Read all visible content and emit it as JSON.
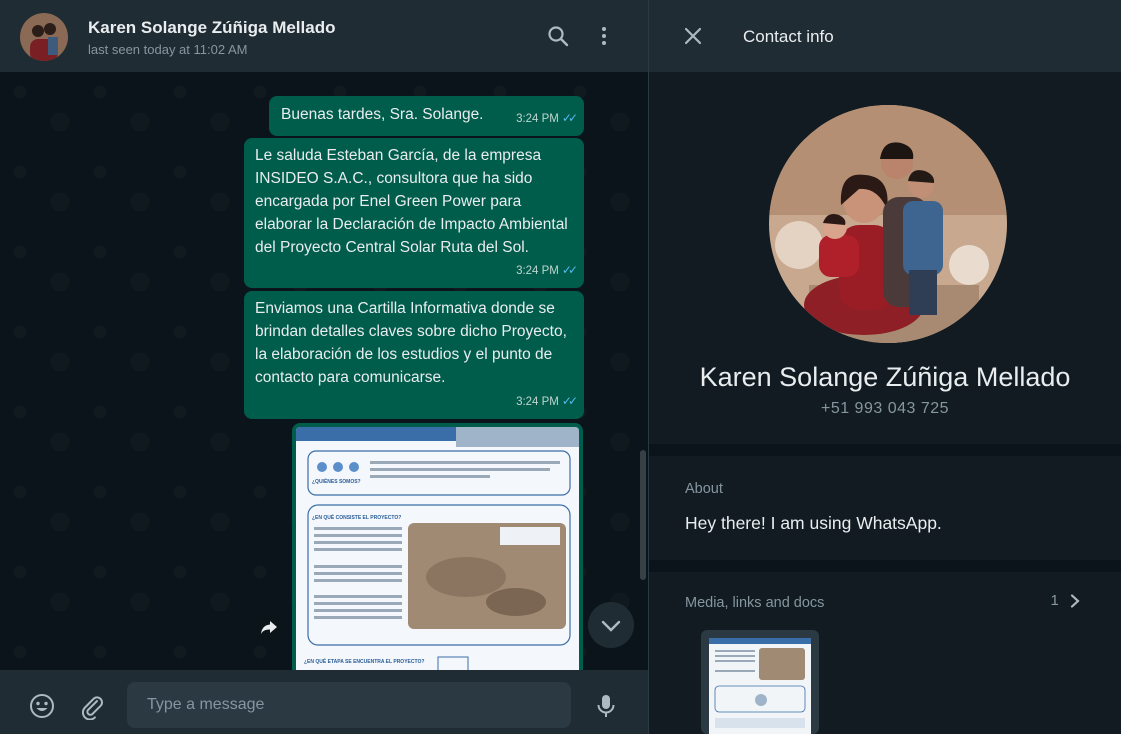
{
  "chat": {
    "contact_name": "Karen Solange Zúñiga Mellado",
    "status": "last seen today at 11:02 AM",
    "messages": [
      {
        "text": "Buenas tardes, Sra. Solange.",
        "time": "3:24 PM"
      },
      {
        "text": "Le saluda Esteban García, de la empresa INSIDEO S.A.C., consultora que ha sido encargada por Enel Green Power para elaborar la Declaración de Impacto Ambiental del Proyecto Central Solar Ruta del Sol.",
        "time": "3:24 PM"
      },
      {
        "text": "Enviamos una Cartilla Informativa donde se brindan detalles claves sobre dicho Proyecto, la elaboración de los estudios y el punto de contacto para comunicarse.",
        "time": "3:24 PM"
      }
    ],
    "document": {
      "section1": "¿QUIÉNES SOMOS?",
      "section2": "¿EN QUÉ CONSISTE EL PROYECTO?",
      "section3": "¿EN QUÉ ETAPA SE ENCUENTRA EL PROYECTO?"
    },
    "input_placeholder": "Type a message"
  },
  "contact_info": {
    "title": "Contact info",
    "name": "Karen Solange Zúñiga Mellado",
    "phone": "+51 993 043 725",
    "about_label": "About",
    "about_text": "Hey there! I am using WhatsApp.",
    "media_label": "Media, links and docs",
    "media_count": "1"
  },
  "colors": {
    "outgoing_bubble": "#005c4b",
    "header_bg": "#202c33",
    "panel_bg": "#111b21",
    "read_ticks": "#53bdeb"
  },
  "icons": [
    "search-icon",
    "menu-icon",
    "emoji-icon",
    "attach-icon",
    "mic-icon",
    "close-icon",
    "chevron-down-icon",
    "forward-icon",
    "chevron-right-icon",
    "double-check-icon"
  ]
}
